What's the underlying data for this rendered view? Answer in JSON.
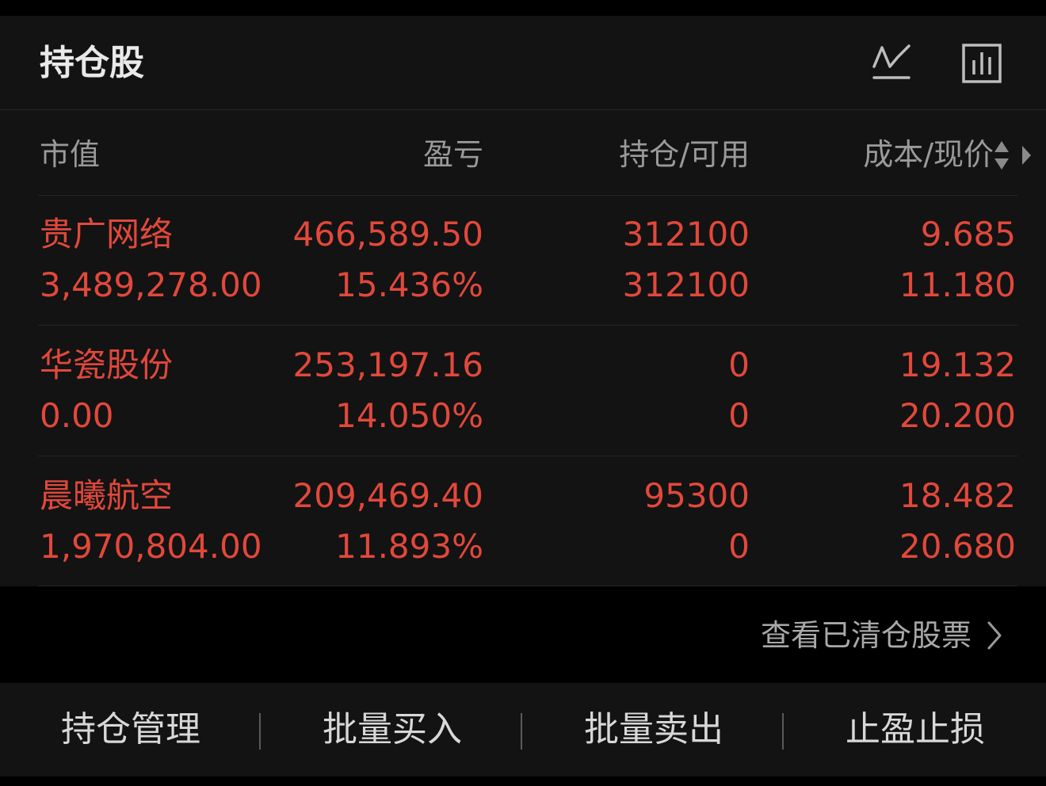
{
  "header": {
    "title": "持仓股",
    "icons": [
      "line-chart-icon",
      "bar-chart-icon"
    ]
  },
  "columns": {
    "market_value": "市值",
    "pnl": "盈亏",
    "position_available": "持仓/可用",
    "cost_price": "成本/现价"
  },
  "holdings": [
    {
      "name": "贵广网络",
      "market_value": "3,489,278.00",
      "pnl": "466,589.50",
      "pnl_pct": "15.436%",
      "position": "312100",
      "available": "312100",
      "cost": "9.685",
      "price": "11.180"
    },
    {
      "name": "华瓷股份",
      "market_value": "0.00",
      "pnl": "253,197.16",
      "pnl_pct": "14.050%",
      "position": "0",
      "available": "0",
      "cost": "19.132",
      "price": "20.200"
    },
    {
      "name": "晨曦航空",
      "market_value": "1,970,804.00",
      "pnl": "209,469.40",
      "pnl_pct": "11.893%",
      "position": "95300",
      "available": "0",
      "cost": "18.482",
      "price": "20.680"
    }
  ],
  "cleared_link": "查看已清仓股票",
  "actions": [
    "持仓管理",
    "批量买入",
    "批量卖出",
    "止盈止损"
  ],
  "colors": {
    "accent_red": "#e2483b",
    "background": "#000000",
    "card": "#131313",
    "muted_text": "#9a9a9a"
  }
}
